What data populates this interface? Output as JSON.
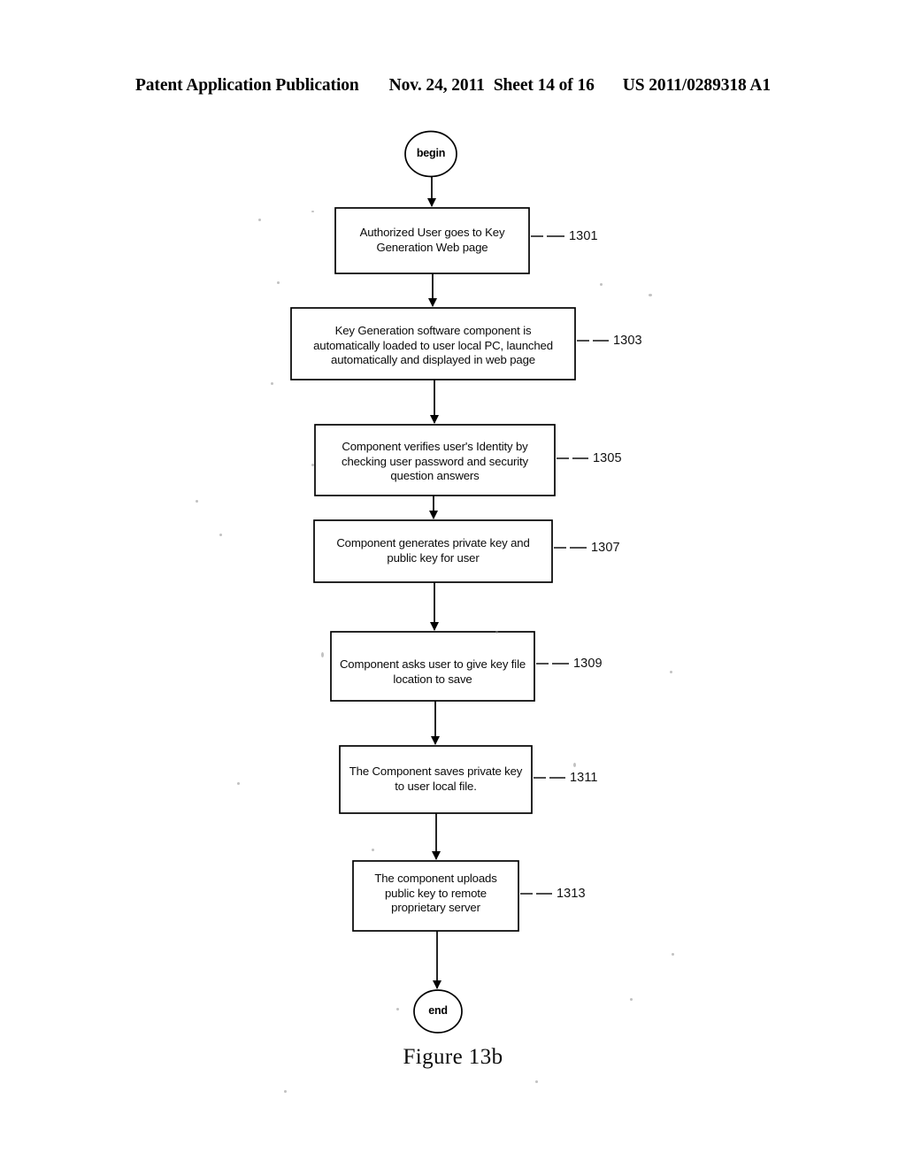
{
  "header": {
    "publication": "Patent Application Publication",
    "date": "Nov. 24, 2011",
    "sheet": "Sheet 14 of 16",
    "patent_number": "US 2011/0289318 A1"
  },
  "figure": {
    "caption": "Figure 13b"
  },
  "chart_data": {
    "type": "diagram",
    "diagram_kind": "flowchart",
    "title": "Figure 13b",
    "orientation": "top-to-bottom",
    "nodes": [
      {
        "id": "begin",
        "shape": "terminator",
        "label": "begin",
        "ref": ""
      },
      {
        "id": "n1301",
        "shape": "process",
        "label": "Authorized User goes to Key\nGeneration Web page",
        "ref": "1301"
      },
      {
        "id": "n1303",
        "shape": "process",
        "label": "Key Generation software component is\nautomatically loaded to user local PC, launched\nautomatically and displayed  in web page",
        "ref": "1303"
      },
      {
        "id": "n1305",
        "shape": "process",
        "label": "Component verifies user's Identity by\nchecking user password and security\nquestion answers",
        "ref": "1305"
      },
      {
        "id": "n1307",
        "shape": "process",
        "label": "Component generates private key and\npublic key for user",
        "ref": "1307"
      },
      {
        "id": "n1309",
        "shape": "process",
        "label": "Component asks user to give key file\nlocation to save",
        "ref": "1309"
      },
      {
        "id": "n1311",
        "shape": "process",
        "label": "The Component saves private key\nto user local file.",
        "ref": "1311"
      },
      {
        "id": "n1313",
        "shape": "process",
        "label": "The component uploads\npublic key to remote\nproprietary server",
        "ref": "1313"
      },
      {
        "id": "end",
        "shape": "terminator",
        "label": "end",
        "ref": ""
      }
    ],
    "edges": [
      {
        "from": "begin",
        "to": "n1301"
      },
      {
        "from": "n1301",
        "to": "n1303"
      },
      {
        "from": "n1303",
        "to": "n1305"
      },
      {
        "from": "n1305",
        "to": "n1307"
      },
      {
        "from": "n1307",
        "to": "n1309"
      },
      {
        "from": "n1309",
        "to": "n1311"
      },
      {
        "from": "n1311",
        "to": "n1313"
      },
      {
        "from": "n1313",
        "to": "end"
      }
    ],
    "colors": {
      "stroke": "#000000",
      "fill": "#ffffff",
      "text": "#000000"
    }
  }
}
